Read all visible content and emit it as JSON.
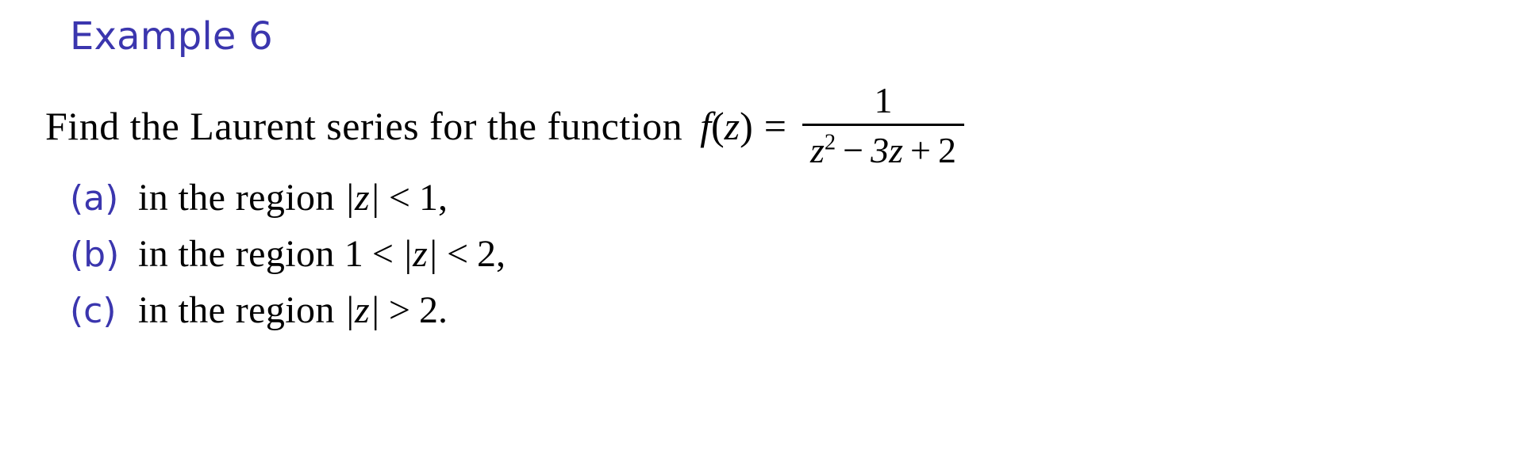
{
  "slide": {
    "title": "Example 6",
    "accent_color": "#3b36ae",
    "text_color": "#000000",
    "background_color": "#ffffff"
  },
  "prompt": {
    "text": "Find the Laurent series for the function",
    "function_name": "f",
    "open_paren": "(",
    "variable": "z",
    "close_paren": ")",
    "equals": "=",
    "fraction": {
      "numerator": "1",
      "denominator_z": "z",
      "denominator_exponent": "2",
      "denominator_minus": "−",
      "denominator_three_z": "3z",
      "denominator_plus": "+",
      "denominator_two": "2"
    }
  },
  "items": [
    {
      "label": "(a)",
      "text": "in the region",
      "math_left": "|z|",
      "relation": "<",
      "math_right": "1,"
    },
    {
      "label": "(b)",
      "text": "in the region",
      "math_left": "1",
      "relation": "<",
      "math_mid": "|z|",
      "relation2": "<",
      "math_right": "2,"
    },
    {
      "label": "(c)",
      "text": "in the region",
      "math_left": "|z|",
      "relation": ">",
      "math_right": "2."
    }
  ]
}
